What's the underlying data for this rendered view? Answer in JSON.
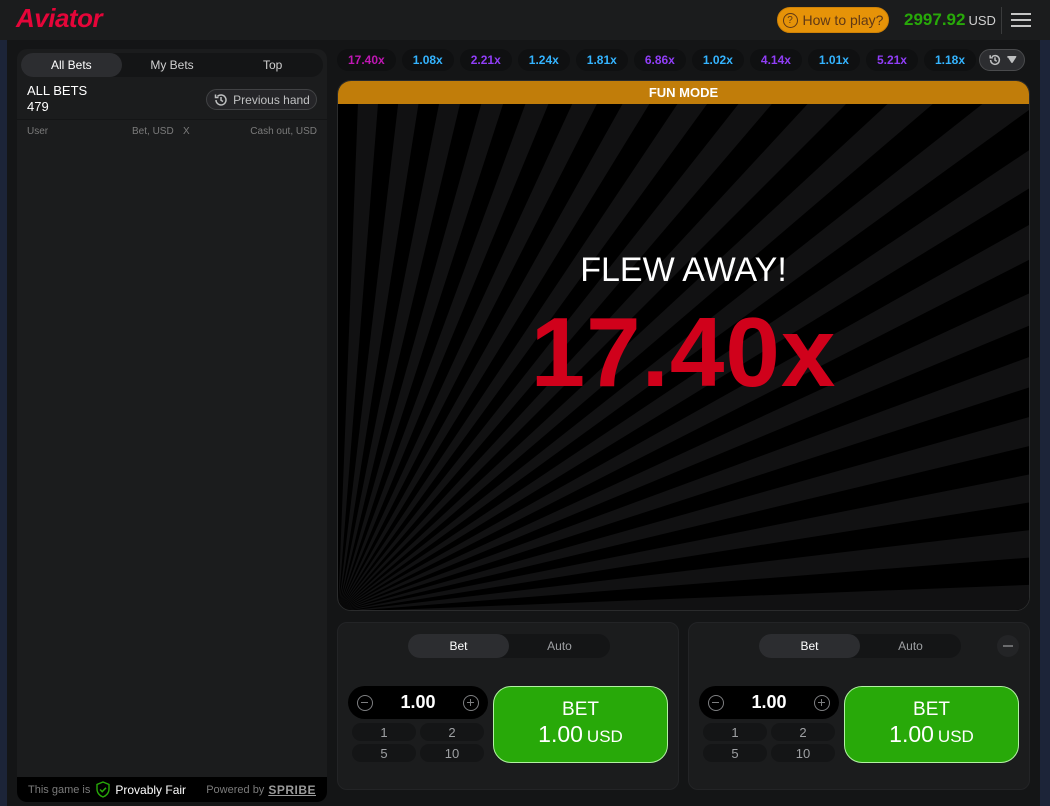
{
  "app": {
    "logo": "Aviator"
  },
  "header": {
    "how_to_play": "How to play?",
    "balance": "2997.92",
    "currency": "USD"
  },
  "bets_panel": {
    "tabs": [
      {
        "label": "All Bets",
        "active": true
      },
      {
        "label": "My Bets",
        "active": false
      },
      {
        "label": "Top",
        "active": false
      }
    ],
    "title": "ALL BETS",
    "count": "479",
    "previous_hand": "Previous hand",
    "columns": [
      "User",
      "Bet, USD",
      "X",
      "Cash out, USD"
    ],
    "footer": {
      "prefix": "This game is",
      "provably_fair": "Provably Fair",
      "powered_by": "Powered by",
      "brand": "SPRIBE"
    }
  },
  "history": [
    {
      "value": "17.40x",
      "color": "#c017b4"
    },
    {
      "value": "1.08x",
      "color": "#34b4ff"
    },
    {
      "value": "2.21x",
      "color": "#913ef8"
    },
    {
      "value": "1.24x",
      "color": "#34b4ff"
    },
    {
      "value": "1.81x",
      "color": "#34b4ff"
    },
    {
      "value": "6.86x",
      "color": "#913ef8"
    },
    {
      "value": "1.02x",
      "color": "#34b4ff"
    },
    {
      "value": "4.14x",
      "color": "#913ef8"
    },
    {
      "value": "1.01x",
      "color": "#34b4ff"
    },
    {
      "value": "5.21x",
      "color": "#913ef8"
    },
    {
      "value": "1.18x",
      "color": "#34b4ff"
    }
  ],
  "game": {
    "mode_banner": "FUN MODE",
    "status": "FLEW AWAY!",
    "multiplier": "17.40x"
  },
  "bet_panels": [
    {
      "tabs": [
        {
          "label": "Bet",
          "active": true
        },
        {
          "label": "Auto",
          "active": false
        }
      ],
      "amount": "1.00",
      "quick": [
        "1",
        "2",
        "5",
        "10"
      ],
      "button_label": "BET",
      "button_amount": "1.00",
      "button_currency": "USD"
    },
    {
      "tabs": [
        {
          "label": "Bet",
          "active": true
        },
        {
          "label": "Auto",
          "active": false
        }
      ],
      "amount": "1.00",
      "quick": [
        "1",
        "2",
        "5",
        "10"
      ],
      "button_label": "BET",
      "button_amount": "1.00",
      "button_currency": "USD"
    }
  ],
  "colors": {
    "accent_red": "#d0011b",
    "bet_green": "#28a909",
    "fun_mode": "#c17d0a",
    "how_to_play": "#e69308"
  }
}
